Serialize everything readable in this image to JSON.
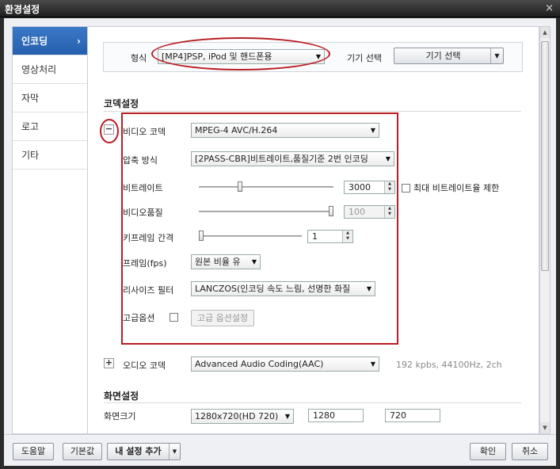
{
  "window": {
    "title": "환경설정",
    "close_glyph": "×"
  },
  "sidebar": {
    "items": [
      {
        "label": "인코딩",
        "active": true,
        "chevron": "›"
      },
      {
        "label": "영상처리"
      },
      {
        "label": "자막"
      },
      {
        "label": "로고"
      },
      {
        "label": "기타"
      }
    ]
  },
  "format": {
    "label": "형식",
    "value": "[MP4]PSP, iPod 및 핸드폰용",
    "device_label": "기기 선택",
    "device_button": "기기 선택"
  },
  "codec_section": {
    "title": "코덱설정",
    "video_toggle": "−",
    "video_codec_label": "비디오 코덱",
    "video_codec_value": "MPEG-4 AVC/H.264",
    "compression_label": "압축 방식",
    "compression_value": "[2PASS-CBR]비트레이트,품질기준 2번 인코딩",
    "bitrate_label": "비트레이트",
    "bitrate_value": "3000",
    "bitrate_max_label": "최대 비트레이트율 제한",
    "quality_label": "비디오품질",
    "quality_value": "100",
    "keyframe_label": "키프레임 간격",
    "keyframe_value": "1",
    "fps_label": "프레임(fps)",
    "fps_value": "원본 비율 유",
    "resize_label": "리사이즈 필터",
    "resize_value": "LANCZOS(인코딩 속도 느림, 선명한 화질",
    "advanced_label": "고급옵션",
    "advanced_button": "고급 옵션설정",
    "audio_toggle": "+",
    "audio_codec_label": "오디오 코덱",
    "audio_codec_value": "Advanced Audio Coding(AAC)",
    "audio_info": "192 kpbs, 44100Hz, 2ch"
  },
  "screen_section": {
    "title": "화면설정",
    "size_label": "화면크기",
    "size_value": "1280x720(HD 720)",
    "width_value": "1280",
    "height_value": "720"
  },
  "footer": {
    "help": "도움말",
    "default": "기본값",
    "add_preset": "내 설정 추가",
    "ok": "확인",
    "cancel": "취소"
  },
  "slider_levels": {
    "bitrate": 0.3,
    "quality": 1.0,
    "keyframe": 0.0
  },
  "colors": {
    "accent": "#2a66b5",
    "annotation": "#b81e24"
  },
  "icons": {
    "close": "close-icon",
    "dropdown": "chevron-down-icon",
    "spin": "spin-arrows-icon"
  }
}
